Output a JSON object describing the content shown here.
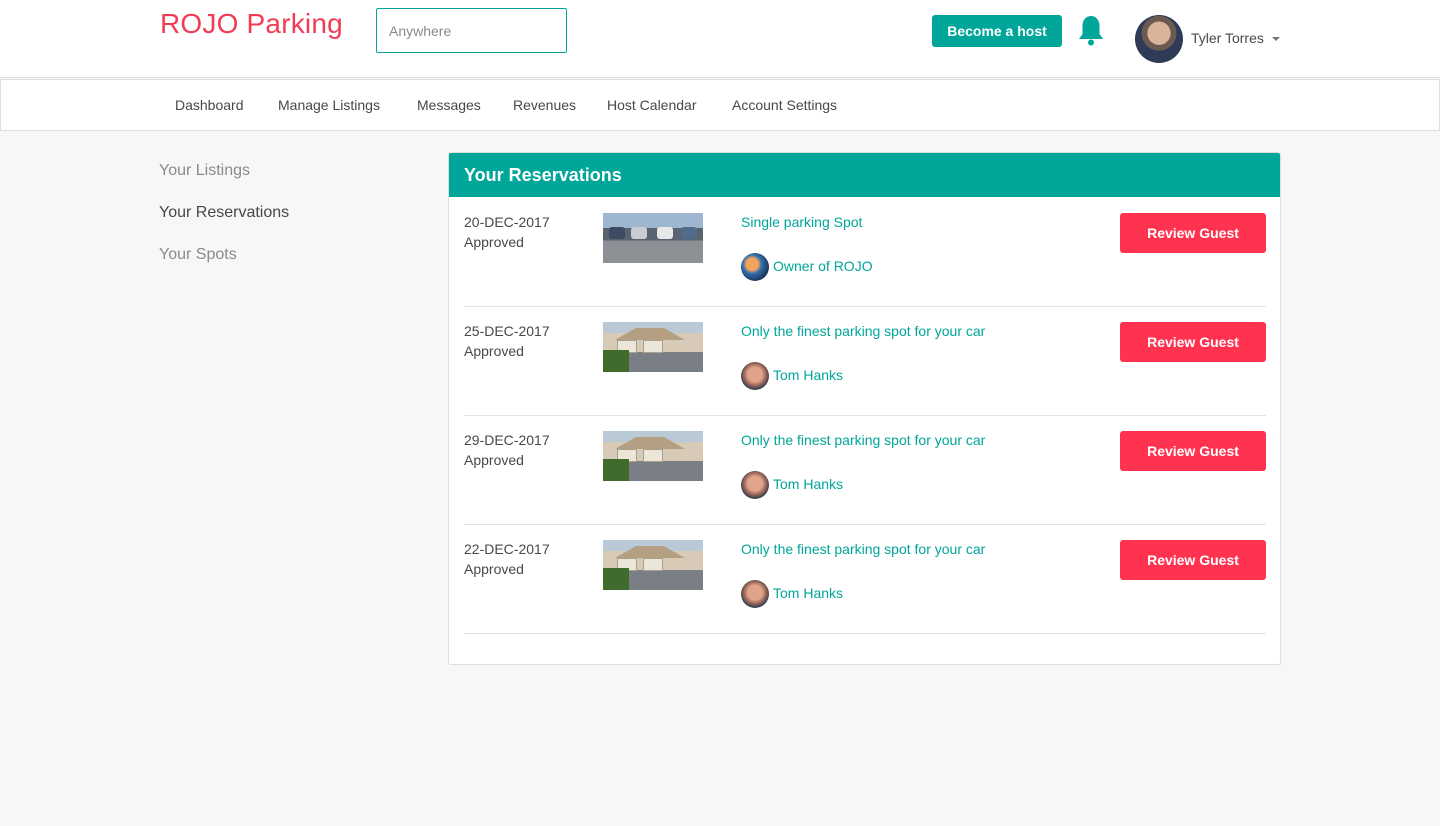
{
  "header": {
    "brand": "ROJO Parking",
    "search_placeholder": "Anywhere",
    "become_host_label": "Become a host",
    "user_name": "Tyler Torres"
  },
  "subnav": {
    "items": [
      "Dashboard",
      "Manage Listings",
      "Messages",
      "Revenues",
      "Host Calendar",
      "Account Settings"
    ]
  },
  "sidebar": {
    "items": [
      {
        "label": "Your Listings",
        "active": false
      },
      {
        "label": "Your Reservations",
        "active": true
      },
      {
        "label": "Your Spots",
        "active": false
      }
    ]
  },
  "panel": {
    "title": "Your Reservations",
    "reservations": [
      {
        "date": "20-DEC-2017",
        "status": "Approved",
        "title": "Single parking Spot",
        "host": "Owner of ROJO",
        "action": "Review Guest",
        "thumb": "parking-lot-image"
      },
      {
        "date": "25-DEC-2017",
        "status": "Approved",
        "title": "Only the finest parking spot for your car",
        "host": "Tom Hanks",
        "action": "Review Guest",
        "thumb": "driveway-image"
      },
      {
        "date": "29-DEC-2017",
        "status": "Approved",
        "title": "Only the finest parking spot for your car",
        "host": "Tom Hanks",
        "action": "Review Guest",
        "thumb": "driveway-image"
      },
      {
        "date": "22-DEC-2017",
        "status": "Approved",
        "title": "Only the finest parking spot for your car",
        "host": "Tom Hanks",
        "action": "Review Guest",
        "thumb": "driveway-image"
      }
    ]
  },
  "colors": {
    "brand": "#f23c55",
    "accent": "#00a699",
    "action": "#ff3350"
  }
}
